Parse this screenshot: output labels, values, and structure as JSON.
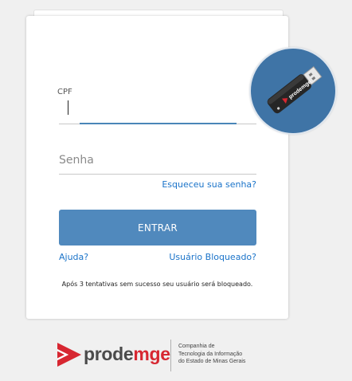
{
  "login": {
    "cpf_label": "CPF",
    "cpf_value": "",
    "password_placeholder": "Senha",
    "forgot_password_link": "Esqueceu sua senha?",
    "enter_button": "ENTRAR",
    "help_link": "Ajuda?",
    "blocked_user_link": "Usuário Bloqueado?",
    "lockout_warning": "Após 3 tentativas sem sucesso seu usuário será bloqueado."
  },
  "badge": {
    "icon": "usb-token-icon",
    "token_brand": "prodemge",
    "background_color": "#3f74a6"
  },
  "footer": {
    "logo_text_main": "prode",
    "logo_text_accent": "mge",
    "subtitle_lines": [
      "Companhia de",
      "Tecnologia da Informação",
      "do Estado de Minas Gerais"
    ]
  },
  "colors": {
    "button": "#5089bd",
    "link": "#1a73c9",
    "input_focus": "#4a86b8",
    "brand_red": "#d72731",
    "page_background": "#f0f0f0"
  }
}
